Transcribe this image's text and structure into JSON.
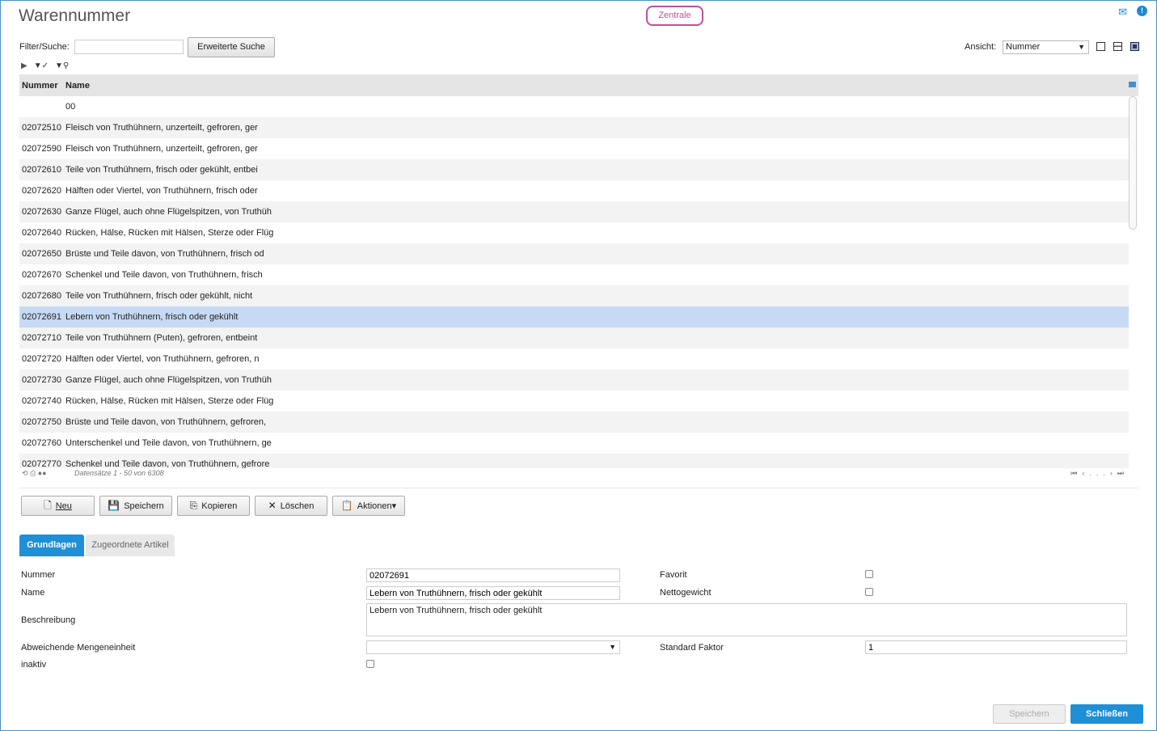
{
  "window": {
    "title": "Warennummer",
    "context_button": "Zentrale"
  },
  "filter": {
    "label": "Filter/Suche:",
    "value": "",
    "extended_search": "Erweiterte Suche"
  },
  "view": {
    "label": "Ansicht:",
    "selected": "Nummer"
  },
  "grid": {
    "headers": [
      "Nummer",
      "Name"
    ],
    "rows": [
      {
        "nummer": "",
        "name": "00"
      },
      {
        "nummer": "02072510",
        "name": "Fleisch von Truthühnern, unzerteilt, gefroren, ger"
      },
      {
        "nummer": "02072590",
        "name": "Fleisch von Truthühnern, unzerteilt, gefroren, ger"
      },
      {
        "nummer": "02072610",
        "name": "Teile von Truthühnern, frisch oder gekühlt, entbei"
      },
      {
        "nummer": "02072620",
        "name": "Hälften oder Viertel, von Truthühnern, frisch oder"
      },
      {
        "nummer": "02072630",
        "name": "Ganze Flügel, auch ohne Flügelspitzen, von Truthüh"
      },
      {
        "nummer": "02072640",
        "name": "Rücken, Hälse, Rücken mit Hälsen, Sterze oder Flüg"
      },
      {
        "nummer": "02072650",
        "name": "Brüste und Teile davon, von Truthühnern, frisch od"
      },
      {
        "nummer": "02072670",
        "name": "Schenkel und Teile davon, von Truthühnern, frisch"
      },
      {
        "nummer": "02072680",
        "name": "Teile von Truthühnern, frisch oder gekühlt, nicht"
      },
      {
        "nummer": "02072691",
        "name": "Lebern von Truthühnern, frisch oder gekühlt"
      },
      {
        "nummer": "02072710",
        "name": "Teile von Truthühnern (Puten), gefroren, entbeint"
      },
      {
        "nummer": "02072720",
        "name": "Hälften oder Viertel, von Truthühnern, gefroren, n"
      },
      {
        "nummer": "02072730",
        "name": "Ganze Flügel, auch ohne Flügelspitzen, von Truthüh"
      },
      {
        "nummer": "02072740",
        "name": "Rücken, Hälse, Rücken mit Hälsen, Sterze oder Flüg"
      },
      {
        "nummer": "02072750",
        "name": "Brüste und Teile davon, von Truthühnern, gefroren,"
      },
      {
        "nummer": "02072760",
        "name": "Unterschenkel und Teile davon, von Truthühnern, ge"
      },
      {
        "nummer": "02072770",
        "name": "Schenkel und Teile davon, von Truthühnern, gefrore"
      }
    ],
    "selected_row": "02072691",
    "pager_info": "Datensätze 1 - 50 von 6308",
    "pager_ellipsis": "..."
  },
  "toolbar": {
    "new": "Neu",
    "save": "Speichern",
    "copy": "Kopieren",
    "delete": "Löschen",
    "actions": "Aktionen"
  },
  "tabs": {
    "basics": "Grundlagen",
    "assigned": "Zugeordnete Artikel"
  },
  "form": {
    "nummer_label": "Nummer",
    "nummer_value": "02072691",
    "name_label": "Name",
    "name_value": "Lebern von Truthühnern, frisch oder gekühlt",
    "beschreibung_label": "Beschreibung",
    "beschreibung_value": "Lebern von Truthühnern, frisch oder gekühlt",
    "mengeneinheit_label": "Abweichende Mengeneinheit",
    "mengeneinheit_value": "",
    "inaktiv_label": "inaktiv",
    "favorit_label": "Favorit",
    "nettogewicht_label": "Nettogewicht",
    "faktor_label": "Standard Faktor",
    "faktor_value": "1"
  },
  "footer": {
    "save": "Speichern",
    "close": "Schließen"
  },
  "colors": {
    "accent": "#1f8fd6",
    "selection": "#c6daf5",
    "context_pill": "#c0509a"
  }
}
